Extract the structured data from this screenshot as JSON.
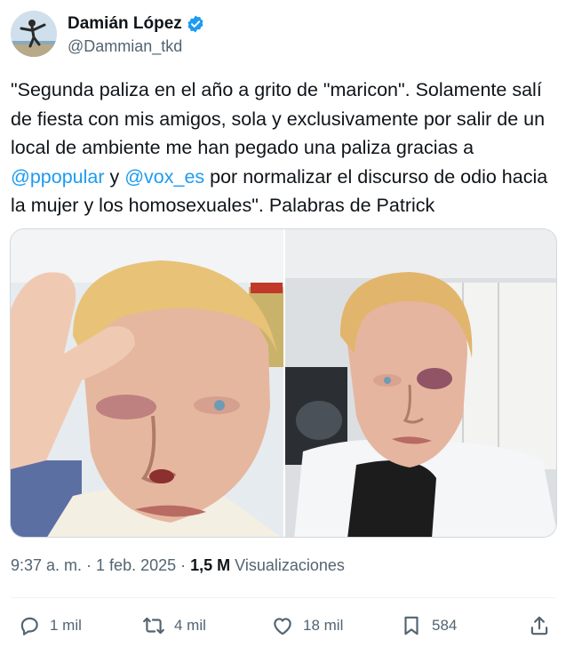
{
  "author": {
    "display_name": "Damián López",
    "handle": "@Dammian_tkd",
    "verified": true
  },
  "tweet": {
    "text_parts": [
      "\"Segunda paliza en el año a grito de \"maricon\". Solamente salí de fiesta con mis amigos, sola y exclusivamente por salir de un local de ambiente me han pegado una paliza gracias a ",
      "@ppopular",
      " y ",
      "@vox_es",
      " por normalizar el discurso de odio hacia la mujer y los homosexuales\". Palabras de Patrick"
    ]
  },
  "media": {
    "photos": [
      "photo-selfie-injured-face",
      "photo-injured-face-hospital"
    ]
  },
  "meta": {
    "time": "9:37 a. m.",
    "sep1": " · ",
    "date": "1 feb. 2025",
    "sep2": " · ",
    "views_count": "1,5 M",
    "views_label": " Visualizaciones"
  },
  "actions": {
    "replies": "1 mil",
    "retweets": "4 mil",
    "likes": "18 mil",
    "bookmarks": "584"
  },
  "colors": {
    "link": "#1d9bf0",
    "secondary_text": "#536471",
    "primary_text": "#0f1419",
    "verified": "#1d9bf0"
  }
}
